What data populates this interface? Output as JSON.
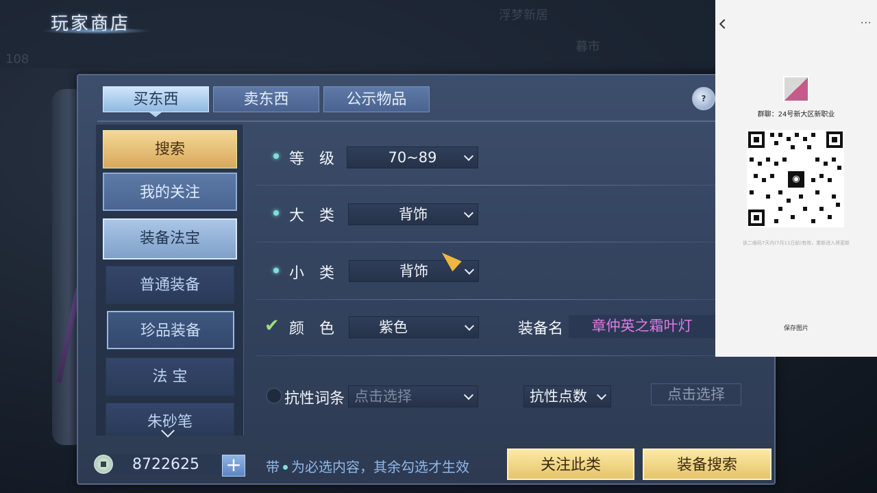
{
  "title": "玩家商店",
  "background_text": [
    "108",
    "浮梦新居",
    "暮市"
  ],
  "tabs": [
    {
      "label": "买东西",
      "active": true
    },
    {
      "label": "卖东西",
      "active": false
    },
    {
      "label": "公示物品",
      "active": false
    }
  ],
  "sidebar": {
    "items": [
      {
        "label": "搜索"
      },
      {
        "label": "我的关注"
      },
      {
        "label": "装备法宝"
      },
      {
        "label": "普通装备"
      },
      {
        "label": "珍品装备"
      },
      {
        "label": "法 宝"
      },
      {
        "label": "朱砂笔"
      }
    ]
  },
  "filters": {
    "level": {
      "label": "等　级",
      "value": "70~89"
    },
    "category": {
      "label": "大　类",
      "value": "背饰"
    },
    "subcategory": {
      "label": "小　类",
      "value": "背饰"
    },
    "color": {
      "label": "颜　色",
      "value": "紫色",
      "checked": true
    },
    "equip_name": {
      "label": "装备名",
      "value": "章仲英之霜叶灯"
    },
    "resist_entry": {
      "label": "抗性词条",
      "placeholder": "点击选择",
      "checked": false
    },
    "resist_points": {
      "label": "抗性点数",
      "button": "点击选择"
    }
  },
  "footer": {
    "money": "8722625",
    "plus": "+",
    "hint_prefix": "带",
    "hint_suffix": "为必选内容，其余勾选才生效",
    "follow_button": "关注此类",
    "search_button": "装备搜索"
  },
  "qr_overlay": {
    "group_name": "群聊：24号新大区新职业",
    "note": "该二维码7天内(7月11日前)有效，重新进入将更新",
    "save_label": "保存图片",
    "more": "···"
  },
  "colors": {
    "accent_gold": "#e6c46a",
    "equip_name_purple": "#e27ae6",
    "required_dot": "#7ee0d8"
  }
}
